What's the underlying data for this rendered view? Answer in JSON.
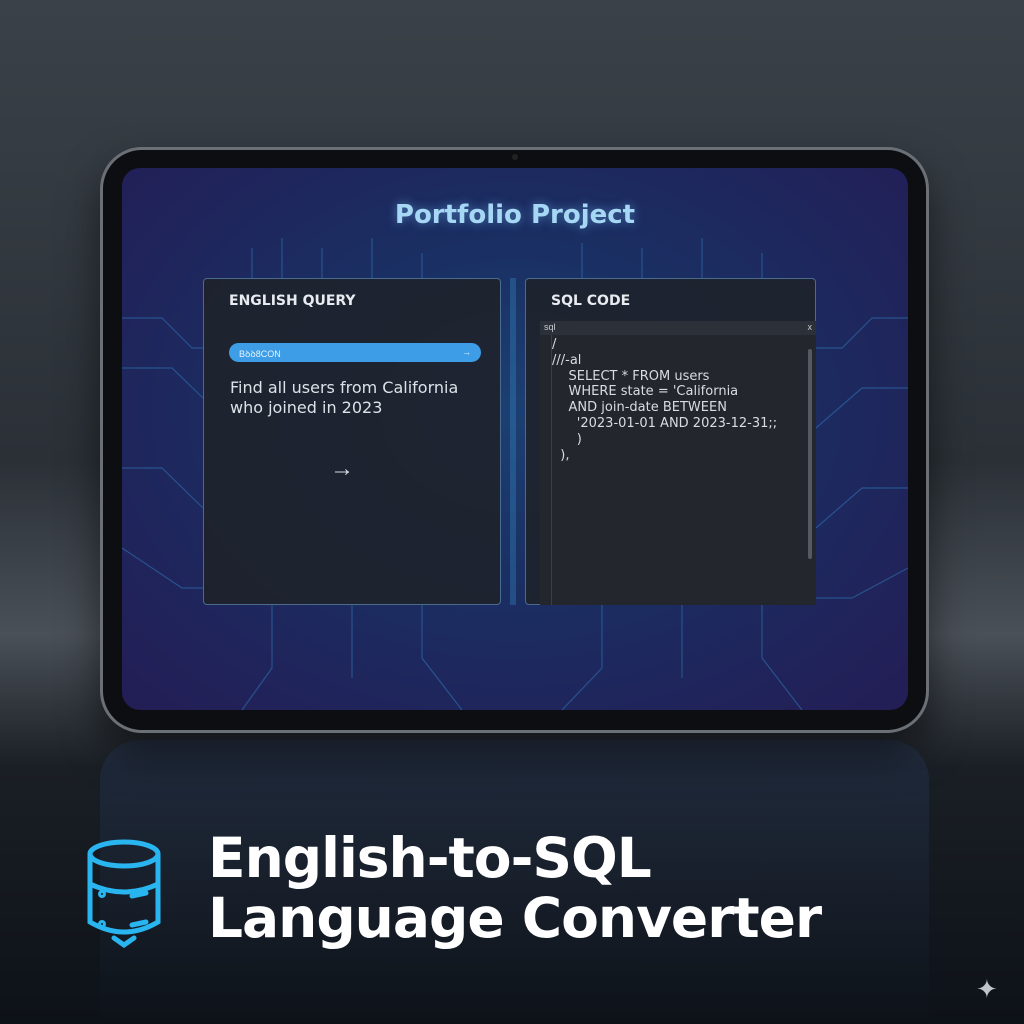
{
  "screen": {
    "title": "Portfolio Project",
    "english_panel": {
      "heading": "ENGLISH QUERY",
      "input_bar_text": "Bꝺꝺ8CON",
      "input_bar_icon": "arrow-right-icon",
      "query": "Find all users from California who joined in 2023",
      "submit_icon": "arrow-right-icon"
    },
    "sql_panel": {
      "heading": "SQL CODE",
      "tab_label": "sql",
      "tab_close": "x",
      "code": "/\n///-al\n    SELECT * FROM users\n    WHERE state = 'California\n    AND join-date BETWEEN\n      '2023-01-01 AND 2023-12-31;;\n      )\n  ),"
    }
  },
  "caption": {
    "line1": "English-to-SQL",
    "line2": "Language Converter",
    "icon": "database-icon"
  },
  "colors": {
    "accent": "#3d9de6",
    "title": "#a6d8f5",
    "icon": "#29b6f0"
  }
}
